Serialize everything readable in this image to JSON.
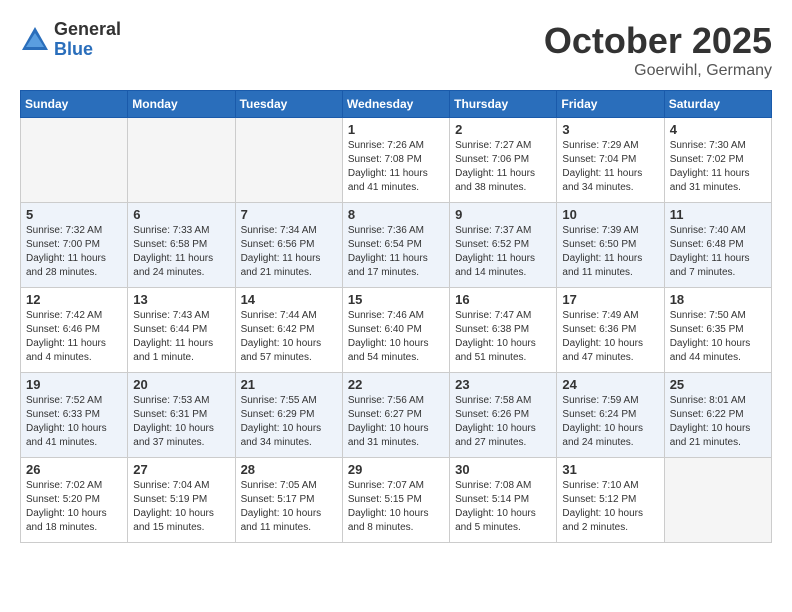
{
  "header": {
    "logo_general": "General",
    "logo_blue": "Blue",
    "month": "October 2025",
    "location": "Goerwihl, Germany"
  },
  "weekdays": [
    "Sunday",
    "Monday",
    "Tuesday",
    "Wednesday",
    "Thursday",
    "Friday",
    "Saturday"
  ],
  "weeks": [
    [
      {
        "day": "",
        "info": "",
        "empty": true
      },
      {
        "day": "",
        "info": "",
        "empty": true
      },
      {
        "day": "",
        "info": "",
        "empty": true
      },
      {
        "day": "1",
        "info": "Sunrise: 7:26 AM\nSunset: 7:08 PM\nDaylight: 11 hours\nand 41 minutes."
      },
      {
        "day": "2",
        "info": "Sunrise: 7:27 AM\nSunset: 7:06 PM\nDaylight: 11 hours\nand 38 minutes."
      },
      {
        "day": "3",
        "info": "Sunrise: 7:29 AM\nSunset: 7:04 PM\nDaylight: 11 hours\nand 34 minutes."
      },
      {
        "day": "4",
        "info": "Sunrise: 7:30 AM\nSunset: 7:02 PM\nDaylight: 11 hours\nand 31 minutes."
      }
    ],
    [
      {
        "day": "5",
        "info": "Sunrise: 7:32 AM\nSunset: 7:00 PM\nDaylight: 11 hours\nand 28 minutes."
      },
      {
        "day": "6",
        "info": "Sunrise: 7:33 AM\nSunset: 6:58 PM\nDaylight: 11 hours\nand 24 minutes."
      },
      {
        "day": "7",
        "info": "Sunrise: 7:34 AM\nSunset: 6:56 PM\nDaylight: 11 hours\nand 21 minutes."
      },
      {
        "day": "8",
        "info": "Sunrise: 7:36 AM\nSunset: 6:54 PM\nDaylight: 11 hours\nand 17 minutes."
      },
      {
        "day": "9",
        "info": "Sunrise: 7:37 AM\nSunset: 6:52 PM\nDaylight: 11 hours\nand 14 minutes."
      },
      {
        "day": "10",
        "info": "Sunrise: 7:39 AM\nSunset: 6:50 PM\nDaylight: 11 hours\nand 11 minutes."
      },
      {
        "day": "11",
        "info": "Sunrise: 7:40 AM\nSunset: 6:48 PM\nDaylight: 11 hours\nand 7 minutes."
      }
    ],
    [
      {
        "day": "12",
        "info": "Sunrise: 7:42 AM\nSunset: 6:46 PM\nDaylight: 11 hours\nand 4 minutes."
      },
      {
        "day": "13",
        "info": "Sunrise: 7:43 AM\nSunset: 6:44 PM\nDaylight: 11 hours\nand 1 minute."
      },
      {
        "day": "14",
        "info": "Sunrise: 7:44 AM\nSunset: 6:42 PM\nDaylight: 10 hours\nand 57 minutes."
      },
      {
        "day": "15",
        "info": "Sunrise: 7:46 AM\nSunset: 6:40 PM\nDaylight: 10 hours\nand 54 minutes."
      },
      {
        "day": "16",
        "info": "Sunrise: 7:47 AM\nSunset: 6:38 PM\nDaylight: 10 hours\nand 51 minutes."
      },
      {
        "day": "17",
        "info": "Sunrise: 7:49 AM\nSunset: 6:36 PM\nDaylight: 10 hours\nand 47 minutes."
      },
      {
        "day": "18",
        "info": "Sunrise: 7:50 AM\nSunset: 6:35 PM\nDaylight: 10 hours\nand 44 minutes."
      }
    ],
    [
      {
        "day": "19",
        "info": "Sunrise: 7:52 AM\nSunset: 6:33 PM\nDaylight: 10 hours\nand 41 minutes."
      },
      {
        "day": "20",
        "info": "Sunrise: 7:53 AM\nSunset: 6:31 PM\nDaylight: 10 hours\nand 37 minutes."
      },
      {
        "day": "21",
        "info": "Sunrise: 7:55 AM\nSunset: 6:29 PM\nDaylight: 10 hours\nand 34 minutes."
      },
      {
        "day": "22",
        "info": "Sunrise: 7:56 AM\nSunset: 6:27 PM\nDaylight: 10 hours\nand 31 minutes."
      },
      {
        "day": "23",
        "info": "Sunrise: 7:58 AM\nSunset: 6:26 PM\nDaylight: 10 hours\nand 27 minutes."
      },
      {
        "day": "24",
        "info": "Sunrise: 7:59 AM\nSunset: 6:24 PM\nDaylight: 10 hours\nand 24 minutes."
      },
      {
        "day": "25",
        "info": "Sunrise: 8:01 AM\nSunset: 6:22 PM\nDaylight: 10 hours\nand 21 minutes."
      }
    ],
    [
      {
        "day": "26",
        "info": "Sunrise: 7:02 AM\nSunset: 5:20 PM\nDaylight: 10 hours\nand 18 minutes."
      },
      {
        "day": "27",
        "info": "Sunrise: 7:04 AM\nSunset: 5:19 PM\nDaylight: 10 hours\nand 15 minutes."
      },
      {
        "day": "28",
        "info": "Sunrise: 7:05 AM\nSunset: 5:17 PM\nDaylight: 10 hours\nand 11 minutes."
      },
      {
        "day": "29",
        "info": "Sunrise: 7:07 AM\nSunset: 5:15 PM\nDaylight: 10 hours\nand 8 minutes."
      },
      {
        "day": "30",
        "info": "Sunrise: 7:08 AM\nSunset: 5:14 PM\nDaylight: 10 hours\nand 5 minutes."
      },
      {
        "day": "31",
        "info": "Sunrise: 7:10 AM\nSunset: 5:12 PM\nDaylight: 10 hours\nand 2 minutes."
      },
      {
        "day": "",
        "info": "",
        "empty": true
      }
    ]
  ]
}
